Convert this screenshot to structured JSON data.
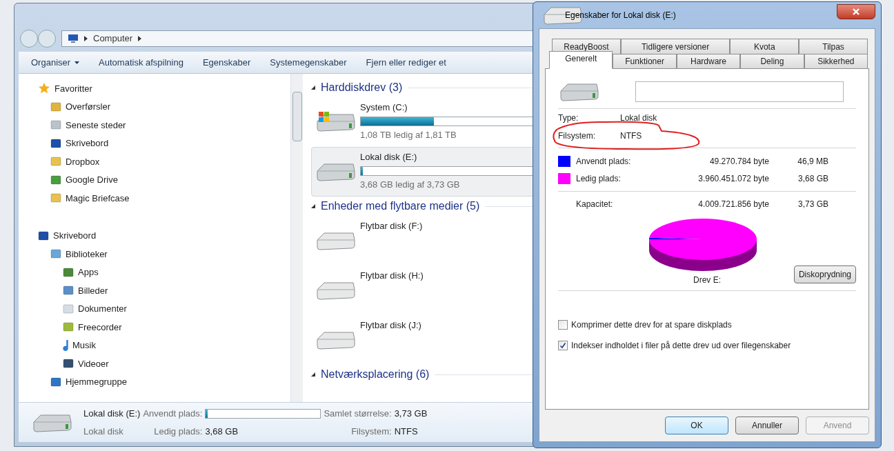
{
  "explorer": {
    "breadcrumb": [
      "Computer"
    ],
    "toolbar": [
      {
        "label": "Organiser",
        "dropdown": true
      },
      {
        "label": "Automatisk afspilning",
        "dropdown": false
      },
      {
        "label": "Egenskaber",
        "dropdown": false
      },
      {
        "label": "Systemegenskaber",
        "dropdown": false
      },
      {
        "label": "Fjern eller rediger et",
        "dropdown": false
      }
    ],
    "sidebar": [
      {
        "label": "Favoritter",
        "kind": "star",
        "children": [
          {
            "label": "Overførsler",
            "kind": "download"
          },
          {
            "label": "Seneste steder",
            "kind": "recent"
          },
          {
            "label": "Skrivebord",
            "kind": "desktop"
          },
          {
            "label": "Dropbox",
            "kind": "folder"
          },
          {
            "label": "Google Drive",
            "kind": "drive"
          },
          {
            "label": "Magic Briefcase",
            "kind": "folder"
          }
        ]
      },
      {
        "label": "Skrivebord",
        "kind": "desktop",
        "children": [
          {
            "label": "Biblioteker",
            "kind": "library",
            "children": [
              {
                "label": "Apps",
                "kind": "apps"
              },
              {
                "label": "Billeder",
                "kind": "pictures"
              },
              {
                "label": "Dokumenter",
                "kind": "documents"
              },
              {
                "label": "Freecorder",
                "kind": "media"
              },
              {
                "label": "Musik",
                "kind": "music"
              },
              {
                "label": "Videoer",
                "kind": "video"
              }
            ]
          },
          {
            "label": "Hjemmegruppe",
            "kind": "homegroup"
          }
        ]
      }
    ],
    "groups": [
      {
        "title": "Harddiskdrev (3)",
        "items": [
          {
            "name": "System (C:)",
            "kind": "system",
            "level": 0.4,
            "info": "1,08 TB ledig af 1,81 TB",
            "selected": false
          },
          {
            "name": "Lokal disk (E:)",
            "kind": "disk",
            "level": 0.013,
            "info": "3,68 GB ledig af 3,73 GB",
            "selected": true
          }
        ]
      },
      {
        "title": "Enheder med flytbare medier (5)",
        "items": [
          {
            "name": "Flytbar disk (F:)",
            "kind": "removable",
            "selected": false
          },
          {
            "name": "Flytbar disk (H:)",
            "kind": "removable",
            "selected": false
          },
          {
            "name": "Flytbar disk (J:)",
            "kind": "removable",
            "selected": false
          }
        ]
      },
      {
        "title": "Netværksplacering (6)"
      }
    ],
    "details": {
      "name": "Lokal disk (E:)",
      "type": "Lokal disk",
      "used_label": "Anvendt plads:",
      "level": 0.013,
      "free_label": "Ledig plads:",
      "free": "3,68 GB",
      "total_label": "Samlet størrelse:",
      "total": "3,73 GB",
      "fs_label": "Filsystem:",
      "fs": "NTFS"
    }
  },
  "dialog": {
    "title": "Egenskaber for Lokal disk (E:)",
    "tabs_back": [
      {
        "label": "ReadyBoost",
        "selected": false
      },
      {
        "label": "Tidligere versioner",
        "selected": false
      },
      {
        "label": "Kvota",
        "selected": false
      },
      {
        "label": "Tilpas",
        "selected": false
      }
    ],
    "tabs_front": [
      {
        "label": "Generelt",
        "selected": true
      },
      {
        "label": "Funktioner",
        "selected": false
      },
      {
        "label": "Hardware",
        "selected": false
      },
      {
        "label": "Deling",
        "selected": false
      },
      {
        "label": "Sikkerhed",
        "selected": false
      }
    ],
    "fields": [
      {
        "label": "Type:",
        "value": "Lokal disk"
      },
      {
        "label": "Filsystem:",
        "value": "NTFS"
      }
    ],
    "usage": [
      {
        "label": "Anvendt plads:",
        "bytes": "49.270.784 byte",
        "size": "46,9 MB",
        "color": "#0000ff"
      },
      {
        "label": "Ledig plads:",
        "bytes": "3.960.451.072 byte",
        "size": "3,68 GB",
        "color": "#ff00ff"
      }
    ],
    "capacity": {
      "label": "Kapacitet:",
      "bytes": "4.009.721.856 byte",
      "size": "3,73 GB"
    },
    "drive_label": "Drev E:",
    "cleanup": "Diskoprydning",
    "options": [
      {
        "label": "Komprimer dette drev for at spare diskplads",
        "checked": false
      },
      {
        "label": "Indekser indholdet i filer på dette drev ud over filegenskaber",
        "checked": true
      }
    ],
    "buttons": [
      {
        "label": "OK",
        "kind": "default",
        "disabled": false
      },
      {
        "label": "Annuller",
        "kind": "normal",
        "disabled": false
      },
      {
        "label": "Anvend",
        "kind": "normal",
        "disabled": true
      }
    ]
  }
}
